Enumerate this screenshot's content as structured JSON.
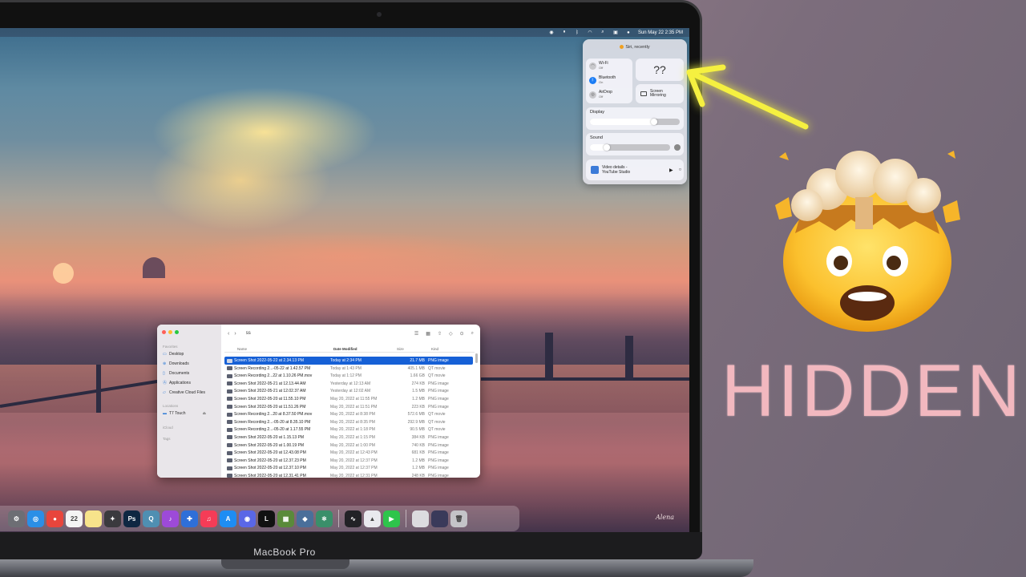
{
  "menubar": {
    "datetime": "Sun May 22  2:35 PM"
  },
  "control_center": {
    "siri_text": "Siri, recently",
    "wifi": {
      "label": "Wi-Fi",
      "state": "Off"
    },
    "bluetooth": {
      "label": "Bluetooth",
      "state": "On"
    },
    "airdrop": {
      "label": "AirDrop",
      "state": "Off"
    },
    "mystery_label": "??",
    "screen_mirroring": {
      "line1": "Screen",
      "line2": "Mirroring"
    },
    "display_label": "Display",
    "display_level": 0.75,
    "sound_label": "Sound",
    "sound_level": 0.25,
    "now_playing": {
      "line1": "Video details -",
      "line2": "YouTube Studio"
    }
  },
  "finder": {
    "folder": "ss",
    "sidebar": {
      "favorites_header": "Favorites",
      "favorites": [
        "Desktop",
        "Downloads",
        "Documents",
        "Applications",
        "Creative Cloud Files"
      ],
      "locations_header": "Locations",
      "locations": [
        "T7 Touch"
      ],
      "icloud_header": "iCloud",
      "tags_header": "Tags"
    },
    "columns": {
      "name": "Name",
      "date": "Date Modified",
      "size": "Size",
      "kind": "Kind"
    },
    "rows": [
      {
        "name": "Screen Shot 2022-05-22 at 2.34.13 PM",
        "date": "Today at 2:34 PM",
        "size": "21.7 MB",
        "kind": "PNG image"
      },
      {
        "name": "Screen Recording 2...-05-22 at 1.42.57 PM",
        "date": "Today at 1:43 PM",
        "size": "405.1 MB",
        "kind": "QT movie"
      },
      {
        "name": "Screen Recording 2...22 at 1.10.26 PM.mov",
        "date": "Today at 1:12 PM",
        "size": "1.66 GB",
        "kind": "QT movie"
      },
      {
        "name": "Screen Shot 2022-05-21 at 12.13.44 AM",
        "date": "Yesterday at 12:13 AM",
        "size": "274 KB",
        "kind": "PNG image"
      },
      {
        "name": "Screen Shot 2022-05-21 at 12.02.37 AM",
        "date": "Yesterday at 12:02 AM",
        "size": "1.5 MB",
        "kind": "PNG image"
      },
      {
        "name": "Screen Shot 2022-05-20 at 11.55.10 PM",
        "date": "May 20, 2022 at 11:55 PM",
        "size": "1.2 MB",
        "kind": "PNG image"
      },
      {
        "name": "Screen Shot 2022-05-20 at 11.51.26 PM",
        "date": "May 20, 2022 at 11:51 PM",
        "size": "223 KB",
        "kind": "PNG image"
      },
      {
        "name": "Screen Recording 2...20 at 8.37.50 PM.mov",
        "date": "May 20, 2022 at 8:38 PM",
        "size": "572.6 MB",
        "kind": "QT movie"
      },
      {
        "name": "Screen Recording 2...-05-20 at 8.35.10 PM",
        "date": "May 20, 2022 at 8:35 PM",
        "size": "292.9 MB",
        "kind": "QT movie"
      },
      {
        "name": "Screen Recording 2...-05-20 at 1.17.55 PM",
        "date": "May 20, 2022 at 1:18 PM",
        "size": "90.5 MB",
        "kind": "QT movie"
      },
      {
        "name": "Screen Shot 2022-05-20 at 1.15.13 PM",
        "date": "May 20, 2022 at 1:15 PM",
        "size": "384 KB",
        "kind": "PNG image"
      },
      {
        "name": "Screen Shot 2022-05-20 at 1.00.19 PM",
        "date": "May 20, 2022 at 1:00 PM",
        "size": "740 KB",
        "kind": "PNG image"
      },
      {
        "name": "Screen Shot 2022-05-20 at 12.43.08 PM",
        "date": "May 20, 2022 at 12:43 PM",
        "size": "681 KB",
        "kind": "PNG image"
      },
      {
        "name": "Screen Shot 2022-05-20 at 12.37.23 PM",
        "date": "May 20, 2022 at 12:37 PM",
        "size": "1.2 MB",
        "kind": "PNG image"
      },
      {
        "name": "Screen Shot 2022-05-20 at 12.37.10 PM",
        "date": "May 20, 2022 at 12:37 PM",
        "size": "1.2 MB",
        "kind": "PNG image"
      },
      {
        "name": "Screen Shot 2022-05-20 at 12.31.41 PM",
        "date": "May 20, 2022 at 12:31 PM",
        "size": "248 KB",
        "kind": "PNG image"
      }
    ]
  },
  "dock": {
    "apps": [
      {
        "name": "system-preferences-icon",
        "color": "#6d6e74",
        "glyph": "⚙"
      },
      {
        "name": "safari-icon",
        "color": "#2b8fe6",
        "glyph": "◎"
      },
      {
        "name": "chrome-icon",
        "color": "#e8453c",
        "glyph": "●"
      },
      {
        "name": "calendar-icon",
        "color": "#f4f4f4",
        "glyph": "22"
      },
      {
        "name": "notes-icon",
        "color": "#f7e38b",
        "glyph": ""
      },
      {
        "name": "final-cut-icon",
        "color": "#3a3a3e",
        "glyph": "✦"
      },
      {
        "name": "photoshop-icon",
        "color": "#0e2742",
        "glyph": "Ps"
      },
      {
        "name": "quicktime-icon",
        "color": "#4f8fb2",
        "glyph": "Q"
      },
      {
        "name": "audio-app-icon",
        "color": "#9d4ad8",
        "glyph": "♪"
      },
      {
        "name": "network-app-icon",
        "color": "#2f6fd8",
        "glyph": "✚"
      },
      {
        "name": "music-icon",
        "color": "#f53c57",
        "glyph": "♫"
      },
      {
        "name": "app-store-icon",
        "color": "#1e8df3",
        "glyph": "A"
      },
      {
        "name": "discord-icon",
        "color": "#5a67e6",
        "glyph": "◉"
      },
      {
        "name": "cursor-app-icon",
        "color": "#111111",
        "glyph": "L"
      },
      {
        "name": "minecraft-icon",
        "color": "#5a8a3a",
        "glyph": "▦"
      },
      {
        "name": "layers-app-icon",
        "color": "#4a6f9a",
        "glyph": "◆"
      },
      {
        "name": "atom-app-icon",
        "color": "#3a8f6a",
        "glyph": "⚛"
      },
      {
        "name": "activity-monitor-icon",
        "color": "#222226",
        "glyph": "∿"
      },
      {
        "name": "preview-icon",
        "color": "#e9e9ee",
        "glyph": "▲"
      },
      {
        "name": "facetime-icon",
        "color": "#2ec54b",
        "glyph": "▶"
      },
      {
        "name": "recent-files-icon",
        "color": "#dcdcdf",
        "glyph": ""
      },
      {
        "name": "recent-window-icon",
        "color": "#3a3a5a",
        "glyph": ""
      },
      {
        "name": "trash-icon",
        "color": "#c4c4c8",
        "glyph": "🗑"
      }
    ]
  },
  "laptop": {
    "brand": "MacBook Pro"
  },
  "wallpaper_signature": "Alena",
  "thumbnail": {
    "headline": "HIDDEN"
  },
  "colors": {
    "accent_yellow": "#f5f040",
    "headline_pink": "#f2b8bf",
    "finder_selection": "#1660d6"
  }
}
